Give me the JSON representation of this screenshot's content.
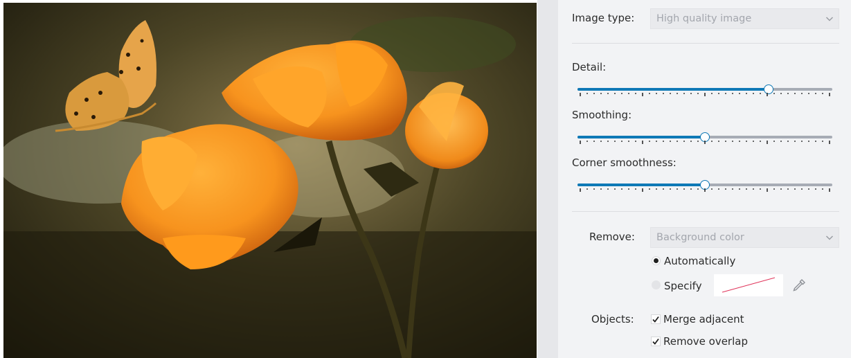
{
  "preview": {
    "alt": "Vectorized image of orange flowers with a butterfly"
  },
  "settings": {
    "image_type": {
      "label": "Image type:",
      "value": "High quality image"
    },
    "detail": {
      "label": "Detail:",
      "value": 0.75
    },
    "smoothing": {
      "label": "Smoothing:",
      "value": 0.5
    },
    "corner_smoothness": {
      "label": "Corner smoothness:",
      "value": 0.5
    },
    "remove": {
      "label": "Remove:",
      "value": "Background color",
      "options": [
        {
          "label": "Automatically",
          "selected": true
        },
        {
          "label": "Specify",
          "selected": false
        }
      ]
    },
    "objects": {
      "label": "Objects:",
      "options": [
        {
          "label": "Merge adjacent",
          "checked": true
        },
        {
          "label": "Remove overlap",
          "checked": true
        }
      ]
    }
  },
  "colors": {
    "accent": "#0f79b6",
    "track": "#a7acb5",
    "panel_bg": "#f2f3f5",
    "swatch_line": "#e0345a"
  },
  "icons": {
    "dropdown": "chevron-down-icon",
    "eyedropper": "eyedropper-icon"
  }
}
